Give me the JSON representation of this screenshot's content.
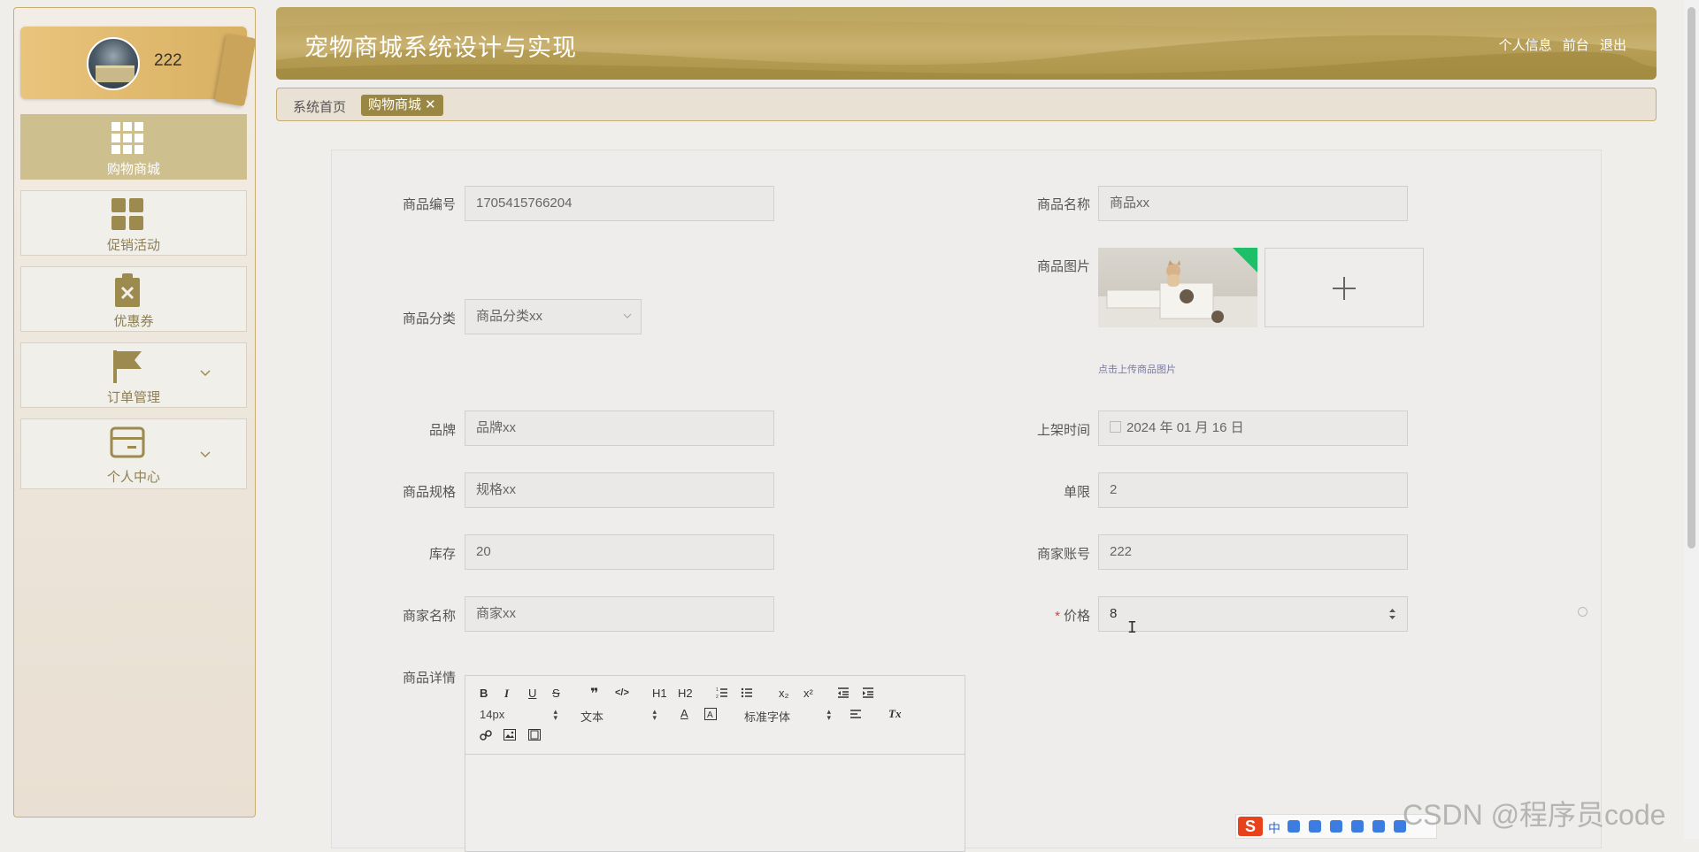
{
  "profile": {
    "name": "222"
  },
  "sidebar": {
    "items": [
      {
        "label": "购物商城",
        "icon": "grid-icon"
      },
      {
        "label": "促销活动",
        "icon": "four-squares-icon"
      },
      {
        "label": "优惠券",
        "icon": "clipboard-x-icon"
      },
      {
        "label": "订单管理",
        "icon": "flag-icon"
      },
      {
        "label": "个人中心",
        "icon": "card-icon"
      }
    ]
  },
  "header": {
    "title": "宠物商城系统设计与实现",
    "links": [
      "个人信息",
      "前台",
      "退出"
    ]
  },
  "breadcrumb": {
    "home": "系统首页",
    "tag": "购物商城",
    "tag_close": "✕"
  },
  "form": {
    "product_no": {
      "label": "商品编号",
      "value": "1705415766204"
    },
    "product_name": {
      "label": "商品名称",
      "value": "商品xx"
    },
    "product_image": {
      "label": "商品图片",
      "hint": "点击上传商品图片"
    },
    "category": {
      "label": "商品分类",
      "value": "商品分类xx"
    },
    "brand": {
      "label": "品牌",
      "value": "品牌xx"
    },
    "listing_time": {
      "label": "上架时间",
      "value": "2024 年 01 月 16 日"
    },
    "spec": {
      "label": "商品规格",
      "value": "规格xx"
    },
    "limit": {
      "label": "单限",
      "value": "2"
    },
    "stock": {
      "label": "库存",
      "value": "20"
    },
    "merchant_account": {
      "label": "商家账号",
      "value": "222"
    },
    "merchant_name": {
      "label": "商家名称",
      "value": "商家xx"
    },
    "price": {
      "label": "价格",
      "required_mark": "*",
      "value": "8"
    },
    "details": {
      "label": "商品详情"
    }
  },
  "editor": {
    "font_size": "14px",
    "text_style": "文本",
    "font_family": "标准字体",
    "buttons": [
      "B",
      "I",
      "U",
      "S",
      "❞",
      "</>",
      "H1",
      "H2",
      "ol",
      "ul",
      "x₂",
      "x²",
      "outdent",
      "indent",
      "A",
      "A-bg",
      "align",
      "Tx",
      "link",
      "image",
      "video"
    ]
  },
  "ime": {
    "brand": "S",
    "mode": "中"
  },
  "watermark": "CSDN @程序员code",
  "colors": {
    "header": "#b59d52",
    "sidebar_active": "#cdbf8e",
    "tag": "#9a8744",
    "required": "#e4393c"
  }
}
